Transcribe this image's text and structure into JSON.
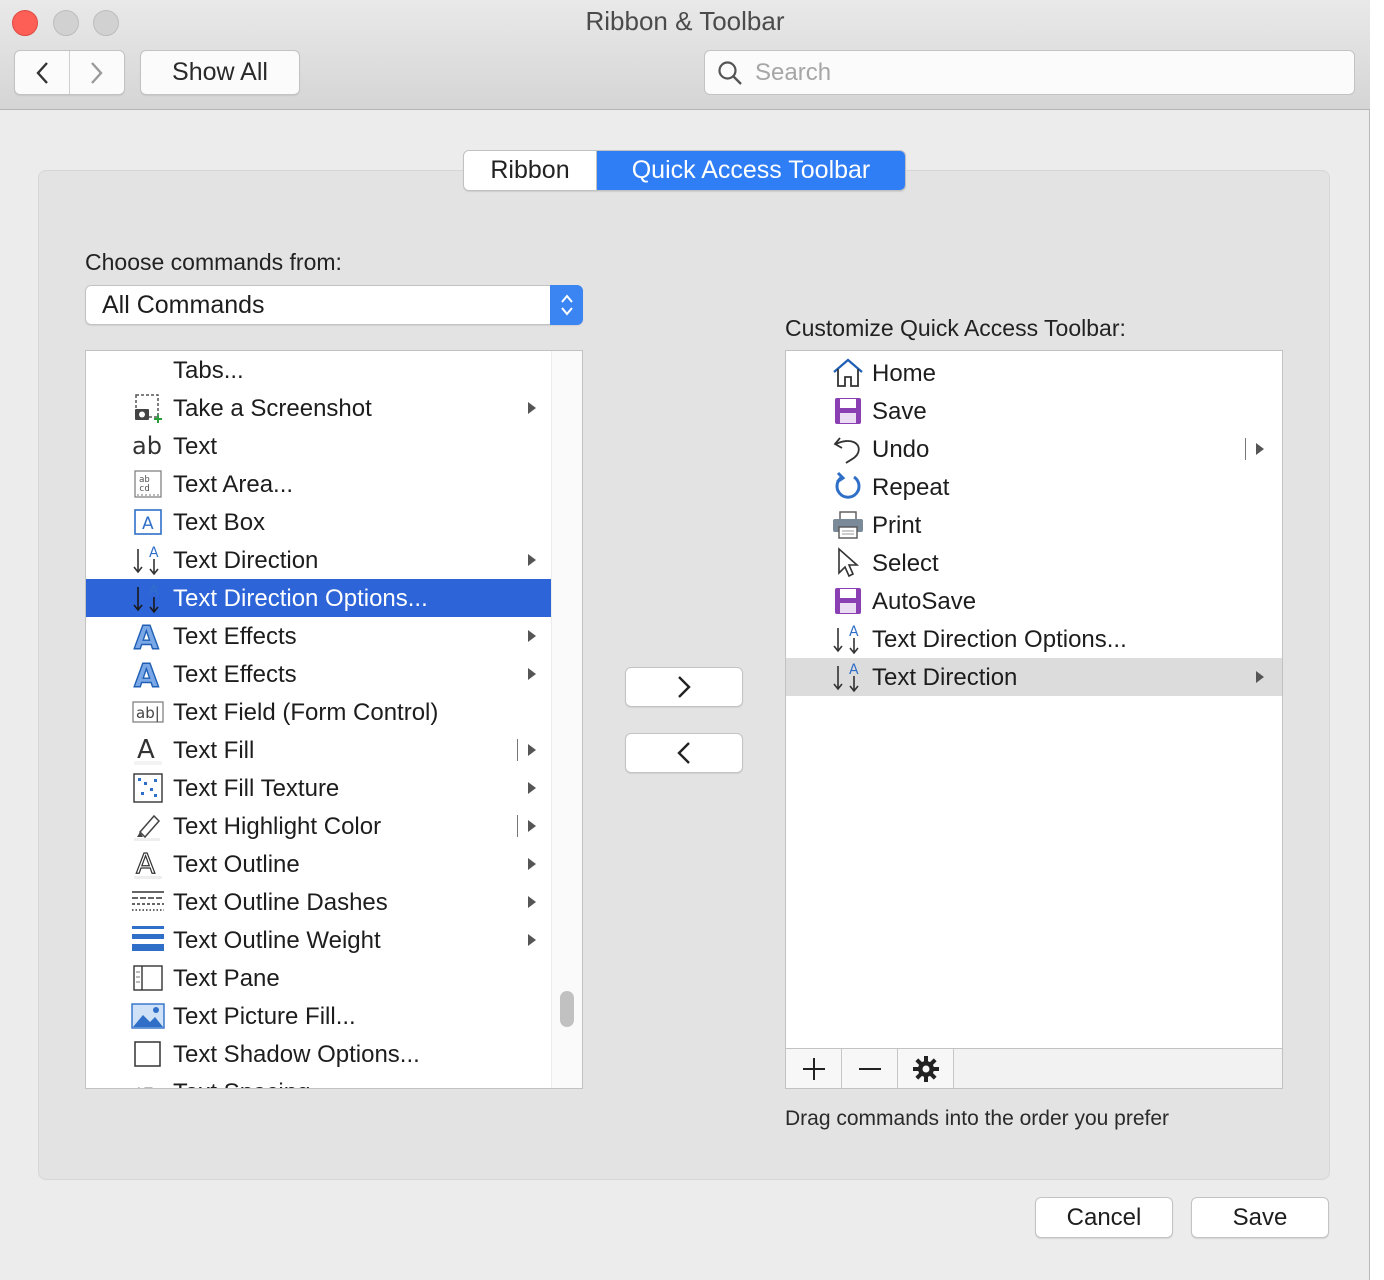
{
  "window": {
    "title": "Ribbon & Toolbar"
  },
  "toolbar": {
    "show_all_label": "Show All",
    "search_placeholder": "Search"
  },
  "tabs": [
    {
      "label": "Ribbon",
      "active": false
    },
    {
      "label": "Quick Access Toolbar",
      "active": true
    }
  ],
  "left": {
    "choose_label": "Choose commands from:",
    "select_value": "All Commands",
    "items": [
      {
        "label": "Tabs...",
        "icon": "none-icon",
        "submenu": false
      },
      {
        "label": "Take a Screenshot",
        "icon": "screenshot-icon",
        "submenu": true
      },
      {
        "label": "Text",
        "icon": "text-ab-icon",
        "submenu": false
      },
      {
        "label": "Text Area...",
        "icon": "text-area-icon",
        "submenu": false
      },
      {
        "label": "Text Box",
        "icon": "text-box-icon",
        "submenu": false
      },
      {
        "label": "Text Direction",
        "icon": "text-direction-icon",
        "submenu": true
      },
      {
        "label": "Text Direction Options...",
        "icon": "text-direction-icon",
        "submenu": false,
        "selected": true
      },
      {
        "label": "Text Effects",
        "icon": "text-effects-icon",
        "submenu": true
      },
      {
        "label": "Text Effects",
        "icon": "text-effects-icon",
        "submenu": true
      },
      {
        "label": "Text Field (Form Control)",
        "icon": "text-field-icon",
        "submenu": false
      },
      {
        "label": "Text Fill",
        "icon": "text-fill-icon",
        "submenu": true,
        "split": true
      },
      {
        "label": "Text Fill Texture",
        "icon": "text-fill-texture-icon",
        "submenu": true
      },
      {
        "label": "Text Highlight Color",
        "icon": "highlighter-icon",
        "submenu": true,
        "split": true
      },
      {
        "label": "Text Outline",
        "icon": "text-outline-icon",
        "submenu": true
      },
      {
        "label": "Text Outline Dashes",
        "icon": "outline-dashes-icon",
        "submenu": true
      },
      {
        "label": "Text Outline Weight",
        "icon": "outline-weight-icon",
        "submenu": true
      },
      {
        "label": "Text Pane",
        "icon": "text-pane-icon",
        "submenu": false
      },
      {
        "label": "Text Picture Fill...",
        "icon": "picture-fill-icon",
        "submenu": false
      },
      {
        "label": "Text Shadow Options...",
        "icon": "shadow-box-icon",
        "submenu": false
      },
      {
        "label": "Text Spacing",
        "icon": "text-spacing-icon",
        "submenu": false
      }
    ]
  },
  "right": {
    "title": "Customize Quick Access Toolbar:",
    "items": [
      {
        "label": "Home",
        "icon": "home-icon",
        "submenu": false
      },
      {
        "label": "Save",
        "icon": "save-icon",
        "submenu": false
      },
      {
        "label": "Undo",
        "icon": "undo-icon",
        "submenu": true,
        "split": true
      },
      {
        "label": "Repeat",
        "icon": "repeat-icon",
        "submenu": false
      },
      {
        "label": "Print",
        "icon": "print-icon",
        "submenu": false
      },
      {
        "label": "Select",
        "icon": "select-cursor-icon",
        "submenu": false
      },
      {
        "label": "AutoSave",
        "icon": "autosave-icon",
        "submenu": false
      },
      {
        "label": "Text Direction Options...",
        "icon": "text-direction-icon",
        "submenu": false
      },
      {
        "label": "Text Direction",
        "icon": "text-direction-icon",
        "submenu": true,
        "highlighted": true
      }
    ],
    "hint": "Drag commands into the order you prefer"
  },
  "buttons": {
    "cancel": "Cancel",
    "save": "Save"
  },
  "colors": {
    "accent": "#2f7ef5",
    "selection": "#2d64d8",
    "save_purple": "#8a3fb3",
    "icon_blue": "#2f6fc8"
  }
}
